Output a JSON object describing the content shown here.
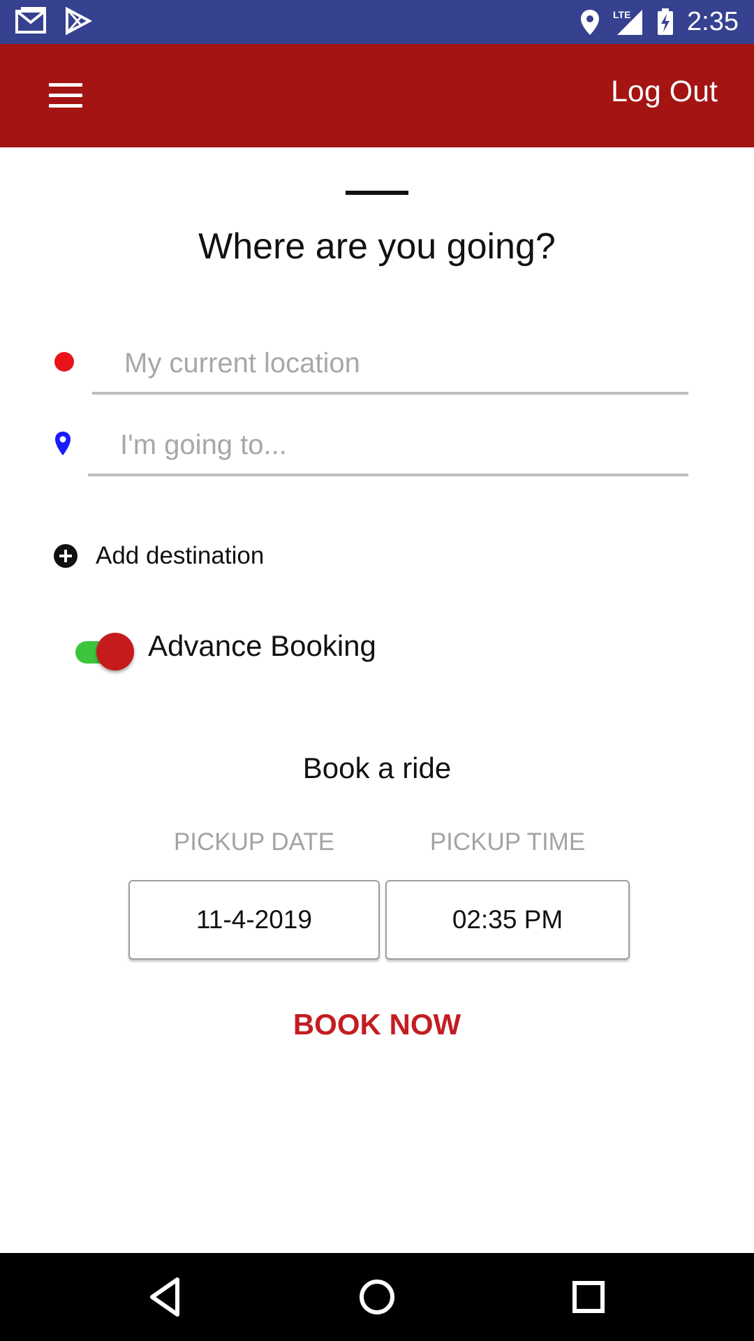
{
  "status_bar": {
    "time": "2:35",
    "network": "LTE",
    "colors": {
      "background": "#36418f"
    }
  },
  "app_bar": {
    "menu_icon": "hamburger-menu-icon",
    "logout_label": "Log Out",
    "colors": {
      "background": "#a31413"
    }
  },
  "sheet": {
    "title": "Where are you going?",
    "origin_placeholder": "My current location",
    "destination_placeholder": "I'm going to...",
    "add_destination_label": "Add destination",
    "advance_booking_label": "Advance Booking",
    "advance_booking_on": true,
    "book_title": "Book a ride",
    "pickup_date_label": "PICKUP DATE",
    "pickup_time_label": "PICKUP TIME",
    "pickup_date_value": "11-4-2019",
    "pickup_time_value": "02:35 PM",
    "book_now_label": "BOOK NOW",
    "colors": {
      "origin_dot": "#e8141a",
      "destination_pin": "#1a1aff",
      "toggle_track": "#3dc43f",
      "toggle_knob": "#c51b1c",
      "book_now": "#c31d22"
    }
  },
  "nav_bar": {
    "icons": [
      "back-icon",
      "home-icon",
      "recents-icon"
    ]
  }
}
